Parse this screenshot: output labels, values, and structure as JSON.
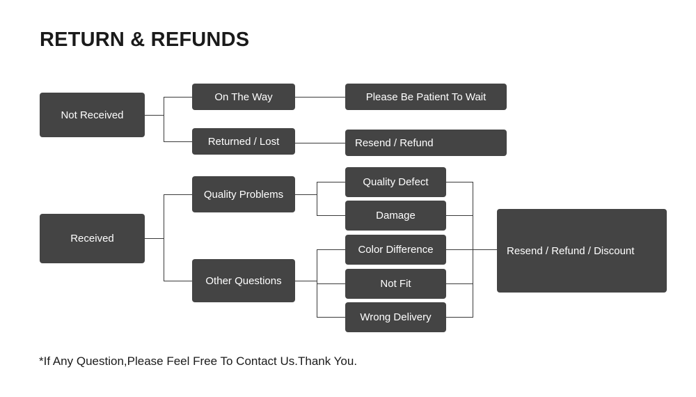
{
  "title": "RETURN & REFUNDS",
  "footer": "*If Any Question,Please Feel Free To Contact Us.Thank You.",
  "colors": {
    "node_fill": "#444444",
    "node_text": "#ffffff",
    "connector": "#3a3a3a",
    "background": "#ffffff",
    "heading_text": "#1a1a1a"
  },
  "chart_data": {
    "type": "diagram",
    "diagram_kind": "flowchart-tree",
    "orientation": "left-to-right",
    "title": "RETURN & REFUNDS",
    "branches": [
      {
        "root": "Not Received",
        "children": [
          {
            "label": "On The Way",
            "outcome": "Please Be Patient To Wait"
          },
          {
            "label": "Returned / Lost",
            "outcome": "Resend / Refund"
          }
        ]
      },
      {
        "root": "Received",
        "children": [
          {
            "label": "Quality Problems",
            "reasons": [
              "Quality Defect",
              "Damage"
            ]
          },
          {
            "label": "Other Questions",
            "reasons": [
              "Color Difference",
              "Not Fit",
              "Wrong Delivery"
            ]
          }
        ],
        "merged_outcome": "Resend / Refund / Discount"
      }
    ]
  },
  "nodes": {
    "not_received": "Not Received",
    "on_the_way": "On The Way",
    "returned_lost": "Returned / Lost",
    "please_wait": "Please Be Patient To Wait",
    "resend_refund": "Resend / Refund",
    "received": "Received",
    "quality_problems": "Quality Problems",
    "other_questions": "Other Questions",
    "quality_defect": "Quality Defect",
    "damage": "Damage",
    "color_difference": "Color Difference",
    "not_fit": "Not Fit",
    "wrong_delivery": "Wrong Delivery",
    "resend_refund_discount": "Resend / Refund / Discount"
  }
}
